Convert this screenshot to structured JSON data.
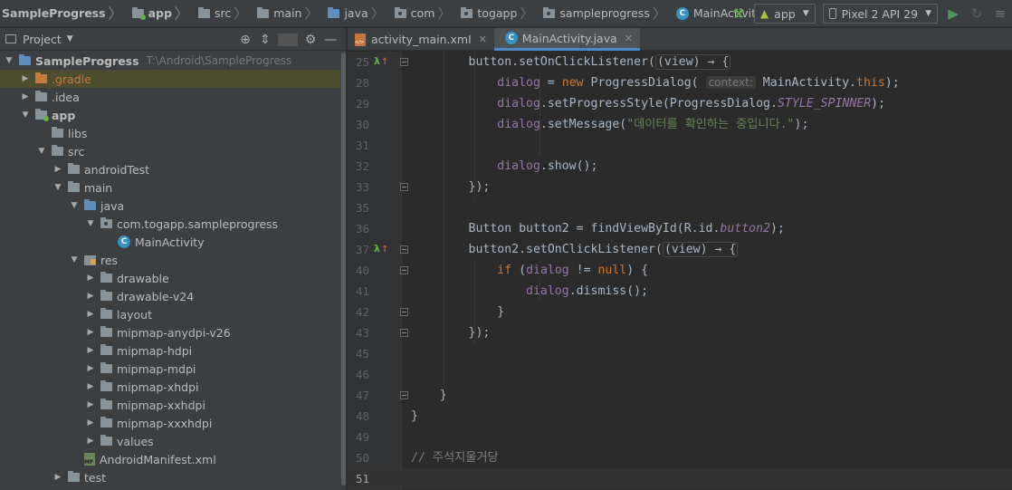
{
  "navbar": {
    "breadcrumbs": [
      {
        "label": "SampleProgress",
        "icon": "project-folder-icon",
        "bold": true
      },
      {
        "label": "app",
        "icon": "module-folder-icon",
        "bold": true
      },
      {
        "label": "src",
        "icon": "folder-icon"
      },
      {
        "label": "main",
        "icon": "folder-icon"
      },
      {
        "label": "java",
        "icon": "source-folder-icon"
      },
      {
        "label": "com",
        "icon": "package-icon"
      },
      {
        "label": "togapp",
        "icon": "package-icon"
      },
      {
        "label": "sampleprogress",
        "icon": "package-icon"
      },
      {
        "label": "MainActivity",
        "icon": "class-icon"
      }
    ],
    "run_config": "app",
    "device": "Pixel 2 API 29"
  },
  "project_panel": {
    "title": "Project",
    "tree": [
      {
        "label": "SampleProgress",
        "extra": "T:\\Android\\SampleProgress",
        "depth": 0,
        "state": "open",
        "icon": "project-folder-icon",
        "bold": true
      },
      {
        "label": ".gradle",
        "depth": 1,
        "state": "closed",
        "icon": "excluded-folder-icon",
        "selected": true
      },
      {
        "label": ".idea",
        "depth": 1,
        "state": "closed",
        "icon": "folder-icon"
      },
      {
        "label": "app",
        "depth": 1,
        "state": "open",
        "icon": "module-folder-icon",
        "bold": true
      },
      {
        "label": "libs",
        "depth": 2,
        "state": "none",
        "icon": "folder-icon"
      },
      {
        "label": "src",
        "depth": 2,
        "state": "open",
        "icon": "folder-icon"
      },
      {
        "label": "androidTest",
        "depth": 3,
        "state": "closed",
        "icon": "folder-icon"
      },
      {
        "label": "main",
        "depth": 3,
        "state": "open",
        "icon": "folder-icon"
      },
      {
        "label": "java",
        "depth": 4,
        "state": "open",
        "icon": "source-folder-icon"
      },
      {
        "label": "com.togapp.sampleprogress",
        "depth": 5,
        "state": "open",
        "icon": "package-icon"
      },
      {
        "label": "MainActivity",
        "depth": 6,
        "state": "none",
        "icon": "class-icon"
      },
      {
        "label": "res",
        "depth": 4,
        "state": "open",
        "icon": "resource-folder-icon"
      },
      {
        "label": "drawable",
        "depth": 5,
        "state": "closed",
        "icon": "folder-icon"
      },
      {
        "label": "drawable-v24",
        "depth": 5,
        "state": "closed",
        "icon": "folder-icon"
      },
      {
        "label": "layout",
        "depth": 5,
        "state": "closed",
        "icon": "folder-icon"
      },
      {
        "label": "mipmap-anydpi-v26",
        "depth": 5,
        "state": "closed",
        "icon": "folder-icon"
      },
      {
        "label": "mipmap-hdpi",
        "depth": 5,
        "state": "closed",
        "icon": "folder-icon"
      },
      {
        "label": "mipmap-mdpi",
        "depth": 5,
        "state": "closed",
        "icon": "folder-icon"
      },
      {
        "label": "mipmap-xhdpi",
        "depth": 5,
        "state": "closed",
        "icon": "folder-icon"
      },
      {
        "label": "mipmap-xxhdpi",
        "depth": 5,
        "state": "closed",
        "icon": "folder-icon"
      },
      {
        "label": "mipmap-xxxhdpi",
        "depth": 5,
        "state": "closed",
        "icon": "folder-icon"
      },
      {
        "label": "values",
        "depth": 5,
        "state": "closed",
        "icon": "folder-icon"
      },
      {
        "label": "AndroidManifest.xml",
        "depth": 4,
        "state": "none",
        "icon": "manifest-file-icon"
      },
      {
        "label": "test",
        "depth": 3,
        "state": "closed",
        "icon": "folder-icon"
      }
    ]
  },
  "tabs": [
    {
      "label": "activity_main.xml",
      "icon": "xml-file-icon",
      "active": false
    },
    {
      "label": "MainActivity.java",
      "icon": "class-icon",
      "active": true
    }
  ],
  "editor": {
    "lines": [
      {
        "num": "25",
        "marker": "lambda",
        "fold": true,
        "code": [
          {
            "t": "        button.setOnClickListener("
          },
          {
            "t": "(view) → {",
            "c": "hintbox"
          }
        ]
      },
      {
        "num": "28",
        "code": [
          {
            "t": "            "
          },
          {
            "t": "dialog",
            "c": "fld"
          },
          {
            "t": " = "
          },
          {
            "t": "new ",
            "c": "kw"
          },
          {
            "t": "ProgressDialog( "
          },
          {
            "t": "context:",
            "c": "hint"
          },
          {
            "t": " MainActivity."
          },
          {
            "t": "this",
            "c": "kw"
          },
          {
            "t": ");"
          }
        ]
      },
      {
        "num": "29",
        "code": [
          {
            "t": "            "
          },
          {
            "t": "dialog",
            "c": "fld"
          },
          {
            "t": ".setProgressStyle(ProgressDialog."
          },
          {
            "t": "STYLE_SPINNER",
            "c": "ital"
          },
          {
            "t": ");"
          }
        ]
      },
      {
        "num": "30",
        "code": [
          {
            "t": "            "
          },
          {
            "t": "dialog",
            "c": "fld"
          },
          {
            "t": ".setMessage("
          },
          {
            "t": "\"데이터를 확인하는 중입니다.\"",
            "c": "str"
          },
          {
            "t": ");"
          }
        ]
      },
      {
        "num": "31",
        "code": []
      },
      {
        "num": "32",
        "code": [
          {
            "t": "            "
          },
          {
            "t": "dialog",
            "c": "fld"
          },
          {
            "t": ".show();"
          }
        ]
      },
      {
        "num": "33",
        "fold": true,
        "code": [
          {
            "t": "        });"
          }
        ]
      },
      {
        "num": "35",
        "code": []
      },
      {
        "num": "36",
        "code": [
          {
            "t": "        Button button2 = findViewById(R.id."
          },
          {
            "t": "button2",
            "c": "ital"
          },
          {
            "t": ");"
          }
        ]
      },
      {
        "num": "37",
        "marker": "lambda",
        "fold": true,
        "code": [
          {
            "t": "        button2.setOnClickListener("
          },
          {
            "t": "(view) → {",
            "c": "hintbox"
          }
        ]
      },
      {
        "num": "40",
        "fold": true,
        "code": [
          {
            "t": "            "
          },
          {
            "t": "if ",
            "c": "kw"
          },
          {
            "t": "("
          },
          {
            "t": "dialog",
            "c": "fld"
          },
          {
            "t": " != "
          },
          {
            "t": "null",
            "c": "kw"
          },
          {
            "t": ") {"
          }
        ]
      },
      {
        "num": "41",
        "code": [
          {
            "t": "                "
          },
          {
            "t": "dialog",
            "c": "fld"
          },
          {
            "t": ".dismiss();"
          }
        ]
      },
      {
        "num": "42",
        "fold": true,
        "code": [
          {
            "t": "            }"
          }
        ]
      },
      {
        "num": "43",
        "fold": true,
        "code": [
          {
            "t": "        });"
          }
        ]
      },
      {
        "num": "45",
        "code": []
      },
      {
        "num": "46",
        "code": []
      },
      {
        "num": "47",
        "fold": true,
        "code": [
          {
            "t": "    }"
          }
        ]
      },
      {
        "num": "48",
        "code": [
          {
            "t": "}"
          }
        ]
      },
      {
        "num": "49",
        "code": []
      },
      {
        "num": "50",
        "code": [
          {
            "t": "// 주석지울거당",
            "c": "cmt"
          }
        ]
      },
      {
        "num": "51",
        "current": true,
        "code": []
      }
    ]
  }
}
